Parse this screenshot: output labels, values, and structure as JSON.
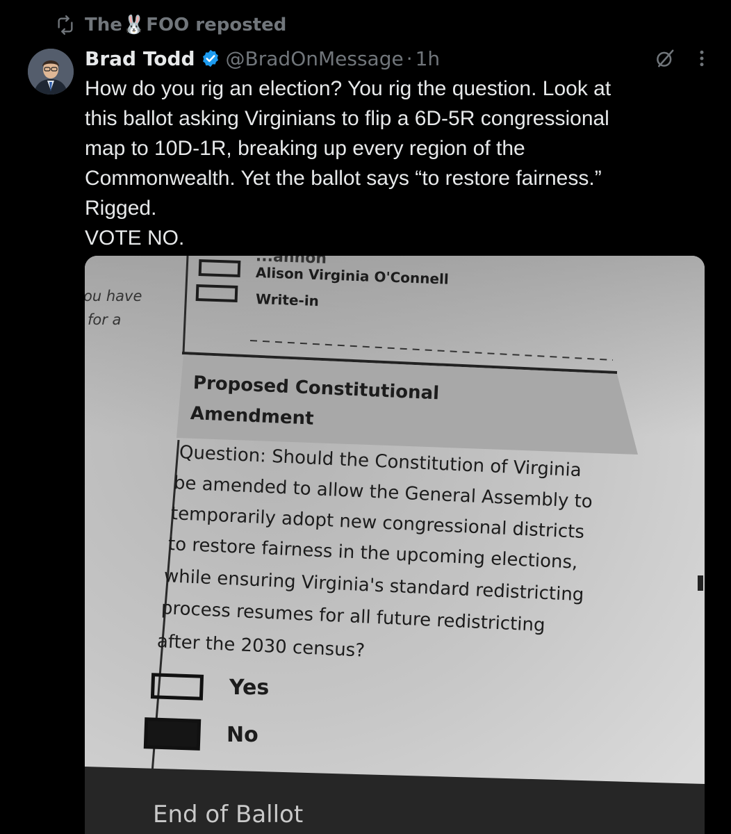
{
  "repost": {
    "label_prefix": "The",
    "label_suffix": "FOO reposted",
    "emoji": "🐰"
  },
  "tweet": {
    "display_name": "Brad Todd",
    "handle": "@BradOnMessage",
    "separator": "·",
    "time": "1h",
    "lines": [
      "How do you rig an election? You rig the question. Look at",
      "this ballot asking Virginians to flip a 6D-5R congressional",
      "map to 10D-1R, breaking up every region of the",
      "Commonwealth. Yet the ballot says “to restore fairness.”",
      "Rigged.",
      "VOTE NO."
    ]
  },
  "ballot": {
    "cut_text": "...annon",
    "left_fragment_1": "ou have",
    "left_fragment_2": "for a",
    "candidate_1": "Alison Virginia O'Connell",
    "candidate_2": "Write-in",
    "section_title_1": "Proposed Constitutional",
    "section_title_2": "Amendment",
    "question_lines": [
      "Question: Should the Constitution of Virginia",
      "be amended to allow the General Assembly to",
      "temporarily adopt new congressional districts",
      "to restore fairness in the upcoming elections,",
      "while ensuring Virginia's standard redistricting",
      "process resumes for all future redistricting",
      "after the 2030 census?"
    ],
    "option_yes": "Yes",
    "option_no": "No",
    "end": "End of Ballot"
  },
  "colors": {
    "background": "#000000",
    "text": "#e7e9ea",
    "muted": "#71767b",
    "verified": "#1d9bf0"
  }
}
